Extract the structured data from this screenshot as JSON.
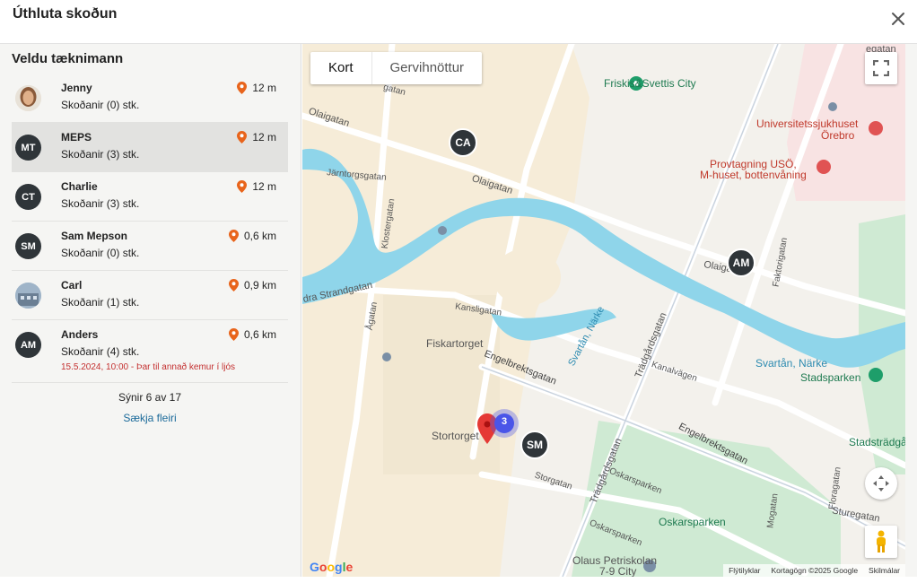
{
  "dialog": {
    "title": "Úthluta skoðun"
  },
  "sidebar": {
    "title": "Veldu tæknimann",
    "technicians": [
      {
        "name": "Jenny",
        "subtitle": "Skoðanir (0) stk.",
        "distance": "12 m",
        "avatar": "photo",
        "initials": ""
      },
      {
        "name": "MEPS",
        "subtitle": "Skoðanir (3) stk.",
        "distance": "12 m",
        "avatar": "initials",
        "initials": "MT"
      },
      {
        "name": "Charlie",
        "subtitle": "Skoðanir (3) stk.",
        "distance": "12 m",
        "avatar": "initials",
        "initials": "CT"
      },
      {
        "name": "Sam Mepson",
        "subtitle": "Skoðanir (0) stk.",
        "distance": "0,6 km",
        "avatar": "initials",
        "initials": "SM"
      },
      {
        "name": "Carl",
        "subtitle": "Skoðanir (1) stk.",
        "distance": "0,9 km",
        "avatar": "photo",
        "initials": ""
      },
      {
        "name": "Anders",
        "subtitle": "Skoðanir (4) stk.",
        "distance": "0,6 km",
        "avatar": "initials",
        "initials": "AM",
        "warning": "15.5.2024, 10:00 - Þar til annað kemur í ljós"
      }
    ],
    "showing": "Sýnir 6 av 17",
    "load_more": "Sækja fleiri"
  },
  "map": {
    "tabs": [
      "Kort",
      "Gervihnöttur"
    ],
    "active_tab": "Kort",
    "markers": [
      "CA",
      "AM",
      "SM"
    ],
    "cluster_count": "3",
    "labels": {
      "friskis": "Friskis&Svettis City",
      "univ1": "Universitetssjukhuset",
      "univ2": "Örebro",
      "prov1": "Provtagning USÖ,",
      "prov2": "M-huset, bottenvåning",
      "olaigatan1": "Olaigatan",
      "olaigatan2": "Olaigatan",
      "olaigatan3": "Olaigatan",
      "jarntorgsgatan": "Järntorgsgatan",
      "klostergatan": "Klostergatan",
      "strandgatan": "dra Strandgatan",
      "agatan": "Ågatan",
      "kansligatan": "Kansligatan",
      "fiskartorget": "Fiskartorget",
      "engelbrektsgatan1": "Engelbrektsgatan",
      "engelbrektsgatan2": "Engelbrektsgatan",
      "svartan1": "Svartån, Närke",
      "svartan2": "Svartån, Närke",
      "stadsparken": "Stadsparken",
      "tradgardsgatan1": "Trädgårdsgatan",
      "tradgardsgatan2": "Trädgårdsgatan",
      "kanalvagen": "Kanalvägen",
      "faktorigatan": "Faktorigatan",
      "stortorget": "Stortorget",
      "storgatan": "Storgatan",
      "oskarsparken": "Oskarsparken",
      "oskarsparken_st1": "Oskarsparken",
      "oskarsparken_st2": "Oskarsparken",
      "olaus1": "Olaus Petriskolan",
      "olaus2": "7-9 City",
      "mogatan": "Mogatan",
      "floragatan": "Floragatan",
      "sturegatan": "Sturegatan",
      "stadstradg": "Stadsträdgå",
      "vegatan": "egatan",
      "gatan": "gatan"
    },
    "footer": {
      "shortcuts": "Flýtilyklar",
      "data": "Kortagögn ©2025 Google",
      "terms": "Skilmálar"
    },
    "google": "Google"
  },
  "colors": {
    "marker": "#2f3539",
    "water": "#8fd5ea",
    "accent_link": "#1b6a9a",
    "warning": "#c43030",
    "pin_orange": "#e8641b",
    "pin_red": "#e53935",
    "cluster": "#4a55e8"
  }
}
